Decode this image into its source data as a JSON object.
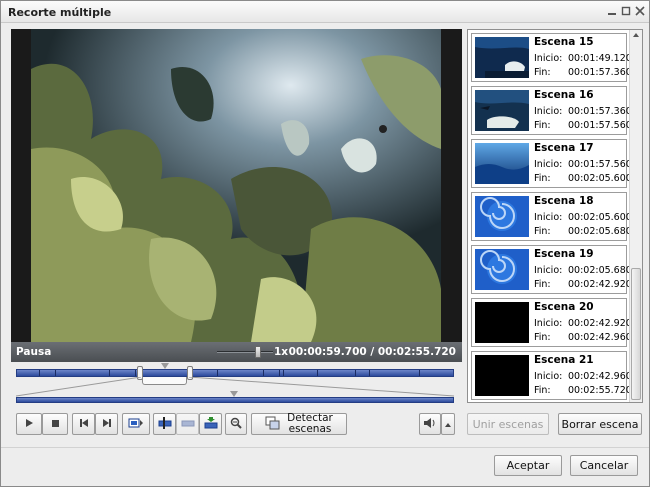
{
  "window": {
    "title": "Recorte múltiple"
  },
  "player": {
    "state": "Pausa",
    "speed": "1x",
    "time": "00:00:59.700  /  00:02:55.720"
  },
  "buttons": {
    "detect_line1": "Detectar",
    "detect_line2": "escenas",
    "merge": "Unir escenas",
    "delete": "Borrar escena",
    "accept": "Aceptar",
    "cancel": "Cancelar"
  },
  "labels": {
    "start": "Inicio:",
    "end": "Fin:"
  },
  "scenes": [
    {
      "name": "Escena 15",
      "start": "00:01:49.120",
      "end": "00:01:57.360",
      "thumb": "reef"
    },
    {
      "name": "Escena 16",
      "start": "00:01:57.360",
      "end": "00:01:57.560",
      "thumb": "reef2"
    },
    {
      "name": "Escena 17",
      "start": "00:01:57.560",
      "end": "00:02:05.600",
      "thumb": "water"
    },
    {
      "name": "Escena 18",
      "start": "00:02:05.600",
      "end": "00:02:05.680",
      "thumb": "swirl"
    },
    {
      "name": "Escena 19",
      "start": "00:02:05.680",
      "end": "00:02:42.920",
      "thumb": "swirl"
    },
    {
      "name": "Escena 20",
      "start": "00:02:42.920",
      "end": "00:02:42.960",
      "thumb": "black"
    },
    {
      "name": "Escena 21",
      "start": "00:02:42.960",
      "end": "00:02:55.720",
      "thumb": "black"
    }
  ],
  "colors": {
    "timeline": "#3a5aad",
    "status_bar": "#5a5e63",
    "accent": "#1b5fb8"
  }
}
